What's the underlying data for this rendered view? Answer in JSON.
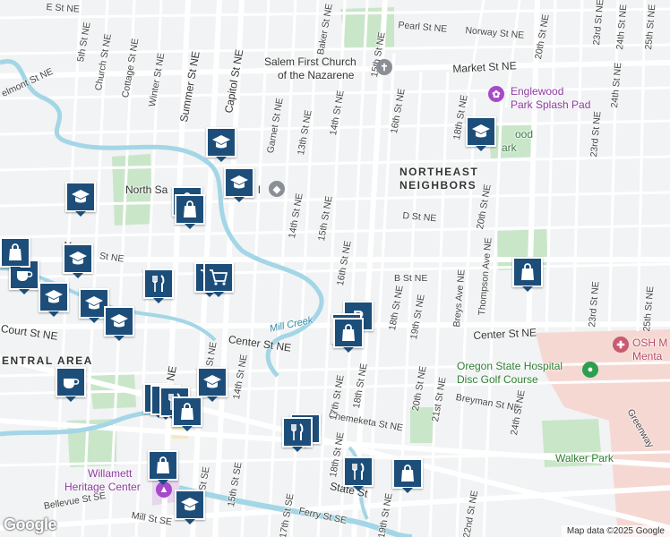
{
  "credit": "Map data ©2025 Google",
  "logo": "Google",
  "colors": {
    "school": "#1d4e7a",
    "road": "#ffffff",
    "park": "#c8e6c9",
    "water": "#a5dbe9",
    "hospital": "#f9d9d6",
    "background": "#f1f3f4"
  },
  "places": {
    "church_line1": "Salem First Church",
    "church_line2": "of the Nazarene",
    "splash_line1": "Englewood",
    "splash_line2": "Park Splash Pad",
    "englewood_park_partial": "ood",
    "englewood_park_partial2": "ark",
    "northeast_line1": "NORTHEAST",
    "northeast_line2": "NEIGHBORS",
    "north_salem_high": "North Sa",
    "north_salem_high_end": "l",
    "central_area": "ENTRAL AREA",
    "mill_creek": "Mill Creek",
    "osh_line1": "OSH M",
    "osh_line2": "Menta",
    "disc_line1": "Oregon State Hospital",
    "disc_line2": "Disc Golf Course",
    "walker_park": "Walker Park",
    "heritage_line1": "Willamett",
    "heritage_line2": "Heritage Center",
    "englewood_road": "Englewood"
  },
  "streets": {
    "E_St": "E St NE",
    "Pearl": "Pearl St NE",
    "Norway": "Norway St NE",
    "Market": "Market St NE",
    "Market_w": "Market St NE",
    "D_St": "D St NE",
    "B_St": "B St NE",
    "Center": "Center St NE",
    "Center_e": "Center St NE",
    "Court": "Court St NE",
    "Chemeketa": "Chemeketa St NE",
    "Breyman": "Breyman St NE",
    "State": "State St",
    "Ferry": "Ferry St SE",
    "Bellevue": "Bellevue St SE",
    "Mill": "Mill St SE",
    "Belmont": "elmont St NE",
    "St_w": "y St NE",
    "5th": "5th St NE",
    "Church": "Church St NE",
    "Cottage": "Cottage St NE",
    "Winter": "Winter St NE",
    "Summer": "Summer St NE",
    "Capitol": "Capitol St NE",
    "Baker": "Baker St NE",
    "Garnet": "Garnet St NE",
    "13th": "13th St NE",
    "14th_n": "14th St NE",
    "14th_m": "14th St NE",
    "15th_n": "15th St NE",
    "15th_m": "15th St NE",
    "16th_n": "16th St NE",
    "16th_m": "16th St NE",
    "17th": "17th St NE",
    "17th_se": "17th St SE",
    "18th_n": "18th St NE",
    "18th_m": "18th St NE",
    "18th_s": "18th St NE",
    "18th_ne2": "18th St NE",
    "19th": "19th St NE",
    "19th_s": "19th St NE",
    "20th_n": "20th St NE",
    "20th_m": "20th St NE",
    "20th_s": "20th St NE",
    "21st": "21st St NE",
    "22nd": "22nd St NE",
    "23rd_n": "23rd St NE",
    "23rd_m": "23rd St NE",
    "23rd_s": "23rd St NE",
    "24th_n": "24th St NE",
    "24th_m": "24th St NE",
    "24th_s": "24th St NE",
    "25th_n": "25th St NE",
    "25th_m": "25th St NE",
    "Breys": "Breys Ave NE",
    "Thompson": "Thompson Ave NE",
    "12th": "12th St NE",
    "14th_se": "14th St SE",
    "15th_se": "15th St SE",
    "12th_se": "12th St SE",
    "13th_s": "St NE",
    "14th_s": "14th St NE",
    "Greenway": "Greenway",
    "Mar_w": "Mar",
    "St_NE_w": "St NE"
  }
}
